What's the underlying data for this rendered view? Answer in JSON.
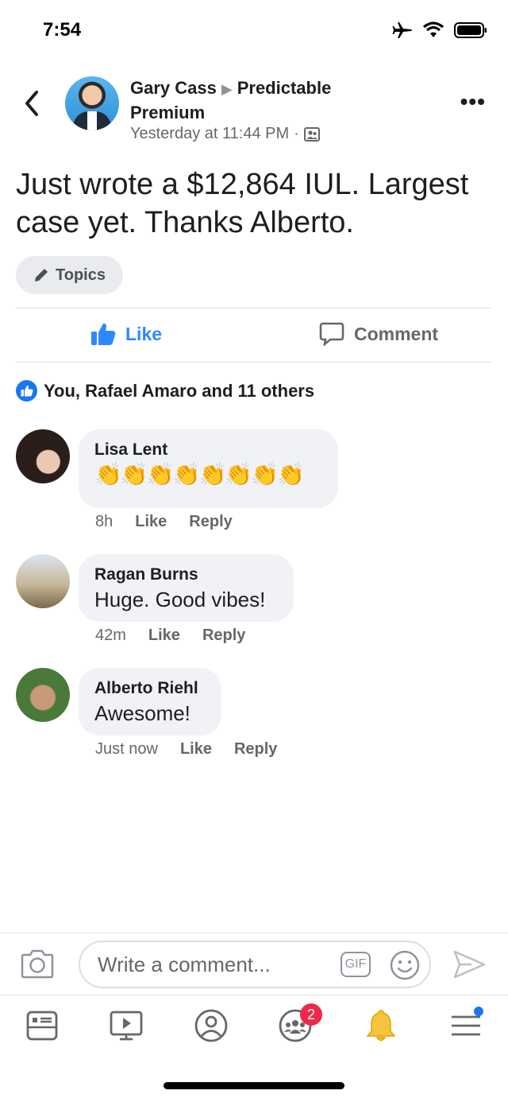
{
  "status_bar": {
    "time": "7:54"
  },
  "post": {
    "author": "Gary Cass",
    "group_line1": "Predictable",
    "group_line2": "Premium",
    "timestamp": "Yesterday at 11:44 PM",
    "separator": "·",
    "body": "Just wrote a $12,864 IUL. Largest case yet. Thanks Alberto.",
    "topics_label": "Topics",
    "like_label": "Like",
    "comment_label": "Comment",
    "reactions_text": "You, Rafael Amaro and 11 others"
  },
  "comments": [
    {
      "name": "Lisa Lent",
      "text": "👏👏👏👏👏👏👏👏",
      "time": "8h",
      "like": "Like",
      "reply": "Reply"
    },
    {
      "name": "Ragan Burns",
      "text": "Huge. Good vibes!",
      "time": "42m",
      "like": "Like",
      "reply": "Reply"
    },
    {
      "name": "Alberto Riehl",
      "text": "Awesome!",
      "time": "Just now",
      "like": "Like",
      "reply": "Reply"
    }
  ],
  "composer": {
    "placeholder": "Write a comment...",
    "gif_label": "GIF"
  },
  "nav": {
    "groups_badge": "2"
  },
  "colors": {
    "accent": "#1877f2",
    "like_blue": "#2d88ff",
    "badge_red": "#f02849",
    "bell_yellow": "#f7c23c"
  },
  "icons": [
    "back-arrow-icon",
    "more-icon",
    "pencil-icon",
    "thumbs-up-icon",
    "comment-icon",
    "camera-icon",
    "gif-icon",
    "emoji-icon",
    "send-icon",
    "news-feed-icon",
    "watch-icon",
    "profile-icon",
    "groups-icon",
    "bell-icon",
    "menu-icon"
  ]
}
